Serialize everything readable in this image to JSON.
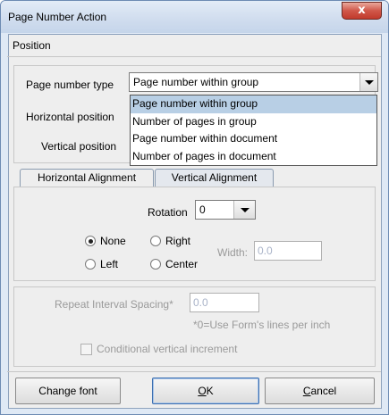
{
  "window": {
    "title": "Page Number Action",
    "close_label": "x"
  },
  "section_label": "Position",
  "page_number_type": {
    "label": "Page number type",
    "selected": "Page number within group",
    "options": [
      "Page number within group",
      "Number of pages in group",
      "Page number within document",
      "Number of pages in document"
    ]
  },
  "horizontal_position": {
    "label": "Horizontal position"
  },
  "vertical_position": {
    "label": "Vertical position"
  },
  "tabs": [
    {
      "label": "Horizontal Alignment",
      "active": true
    },
    {
      "label": "Vertical Alignment",
      "active": false
    }
  ],
  "rotation": {
    "label": "Rotation",
    "value": "0"
  },
  "alignment": {
    "none": "None",
    "right": "Right",
    "left": "Left",
    "center": "Center",
    "selected": "None"
  },
  "width": {
    "label": "Width:",
    "value": "0.0"
  },
  "repeat": {
    "label": "Repeat Interval Spacing*",
    "value": "0.0",
    "note": "*0=Use Form's lines per inch"
  },
  "conditional": {
    "label": "Conditional vertical increment",
    "checked": false
  },
  "buttons": {
    "change_font": "Change font",
    "ok_prefix": "",
    "ok_mnemonic": "O",
    "ok_rest": "K",
    "cancel_mnemonic": "C",
    "cancel_rest": "ancel"
  }
}
